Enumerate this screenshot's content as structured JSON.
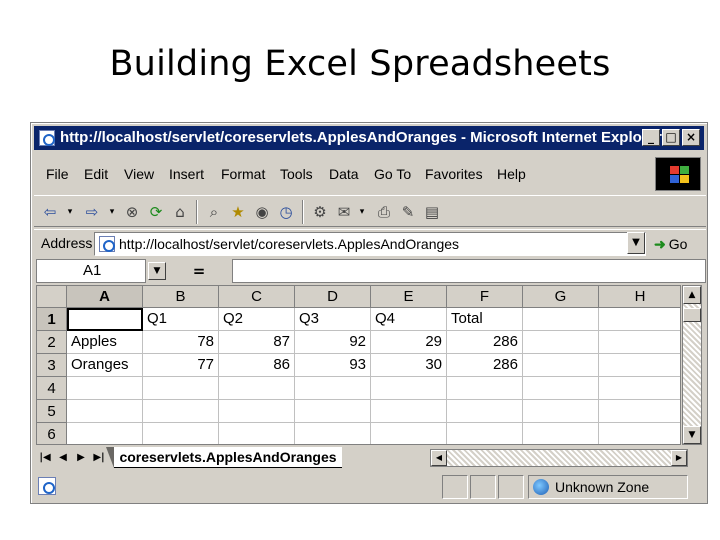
{
  "slide": {
    "title": "Building Excel Spreadsheets"
  },
  "window": {
    "title": "http://localhost/servlet/coreservlets.ApplesAndOranges - Microsoft Internet Explorer",
    "buttons": {
      "minimize": "_",
      "maximize": "□",
      "close": "×"
    }
  },
  "menu": {
    "items": [
      "File",
      "Edit",
      "View",
      "Insert",
      "Format",
      "Tools",
      "Data",
      "Go To",
      "Favorites",
      "Help"
    ]
  },
  "toolbar": {
    "back_icon": "⇦",
    "forward_icon": "⇨"
  },
  "address": {
    "label": "Address",
    "url": "http://localhost/servlet/coreservlets.ApplesAndOranges",
    "go_label": "Go"
  },
  "formula": {
    "cell_ref": "A1",
    "equals": "="
  },
  "sheet": {
    "columns": [
      "A",
      "B",
      "C",
      "D",
      "E",
      "F",
      "G",
      "H"
    ],
    "rows": [
      {
        "num": "1",
        "cells": [
          "",
          "Q1",
          "Q2",
          "Q3",
          "Q4",
          "Total",
          "",
          ""
        ]
      },
      {
        "num": "2",
        "cells": [
          "Apples",
          "78",
          "87",
          "92",
          "29",
          "286",
          "",
          ""
        ]
      },
      {
        "num": "3",
        "cells": [
          "Oranges",
          "77",
          "86",
          "93",
          "30",
          "286",
          "",
          ""
        ]
      },
      {
        "num": "4",
        "cells": [
          "",
          "",
          "",
          "",
          "",
          "",
          "",
          ""
        ]
      },
      {
        "num": "5",
        "cells": [
          "",
          "",
          "",
          "",
          "",
          "",
          "",
          ""
        ]
      },
      {
        "num": "6",
        "cells": [
          "",
          "",
          "",
          "",
          "",
          "",
          "",
          ""
        ]
      }
    ],
    "tab_name": "coreservlets.ApplesAndOranges"
  },
  "status": {
    "zone": "Unknown Zone"
  }
}
